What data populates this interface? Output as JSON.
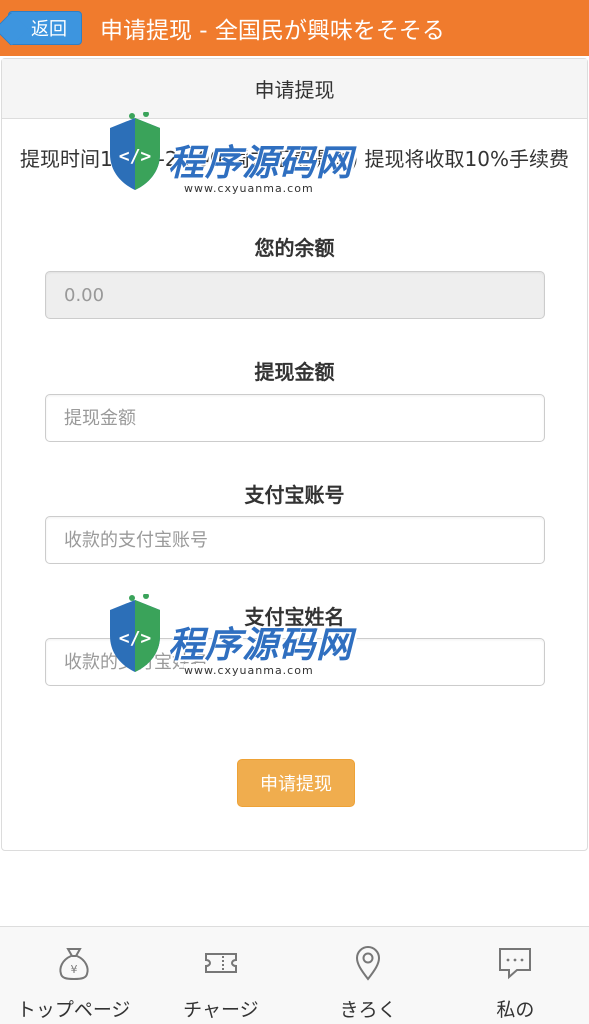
{
  "header": {
    "back_label": "返回",
    "title": "申请提现 - 全国民が興味をそそる"
  },
  "panel": {
    "heading": "申请提现",
    "notice": "提现时间10:00-21:00(周末正常提现) 提现将收取10%手续费"
  },
  "form": {
    "balance": {
      "label": "您的余额",
      "value": "0.00"
    },
    "amount": {
      "label": "提现金额",
      "placeholder": "提现金额"
    },
    "alipay_account": {
      "label": "支付宝账号",
      "placeholder": "收款的支付宝账号"
    },
    "alipay_name": {
      "label": "支付宝姓名",
      "placeholder": "收款的支付宝姓名"
    },
    "submit_label": "申请提现"
  },
  "watermark": {
    "title": "程序源码网",
    "url": "www.cxyuanma.com"
  },
  "tabbar": [
    {
      "label": "トップページ",
      "icon": "money-bag-icon"
    },
    {
      "label": "チャージ",
      "icon": "ticket-icon"
    },
    {
      "label": "きろく",
      "icon": "location-pin-icon"
    },
    {
      "label": "私の",
      "icon": "chat-icon"
    }
  ],
  "colors": {
    "header_bg": "#f07b2d",
    "back_button": "#3d95df",
    "submit_button": "#f0ad4e"
  }
}
